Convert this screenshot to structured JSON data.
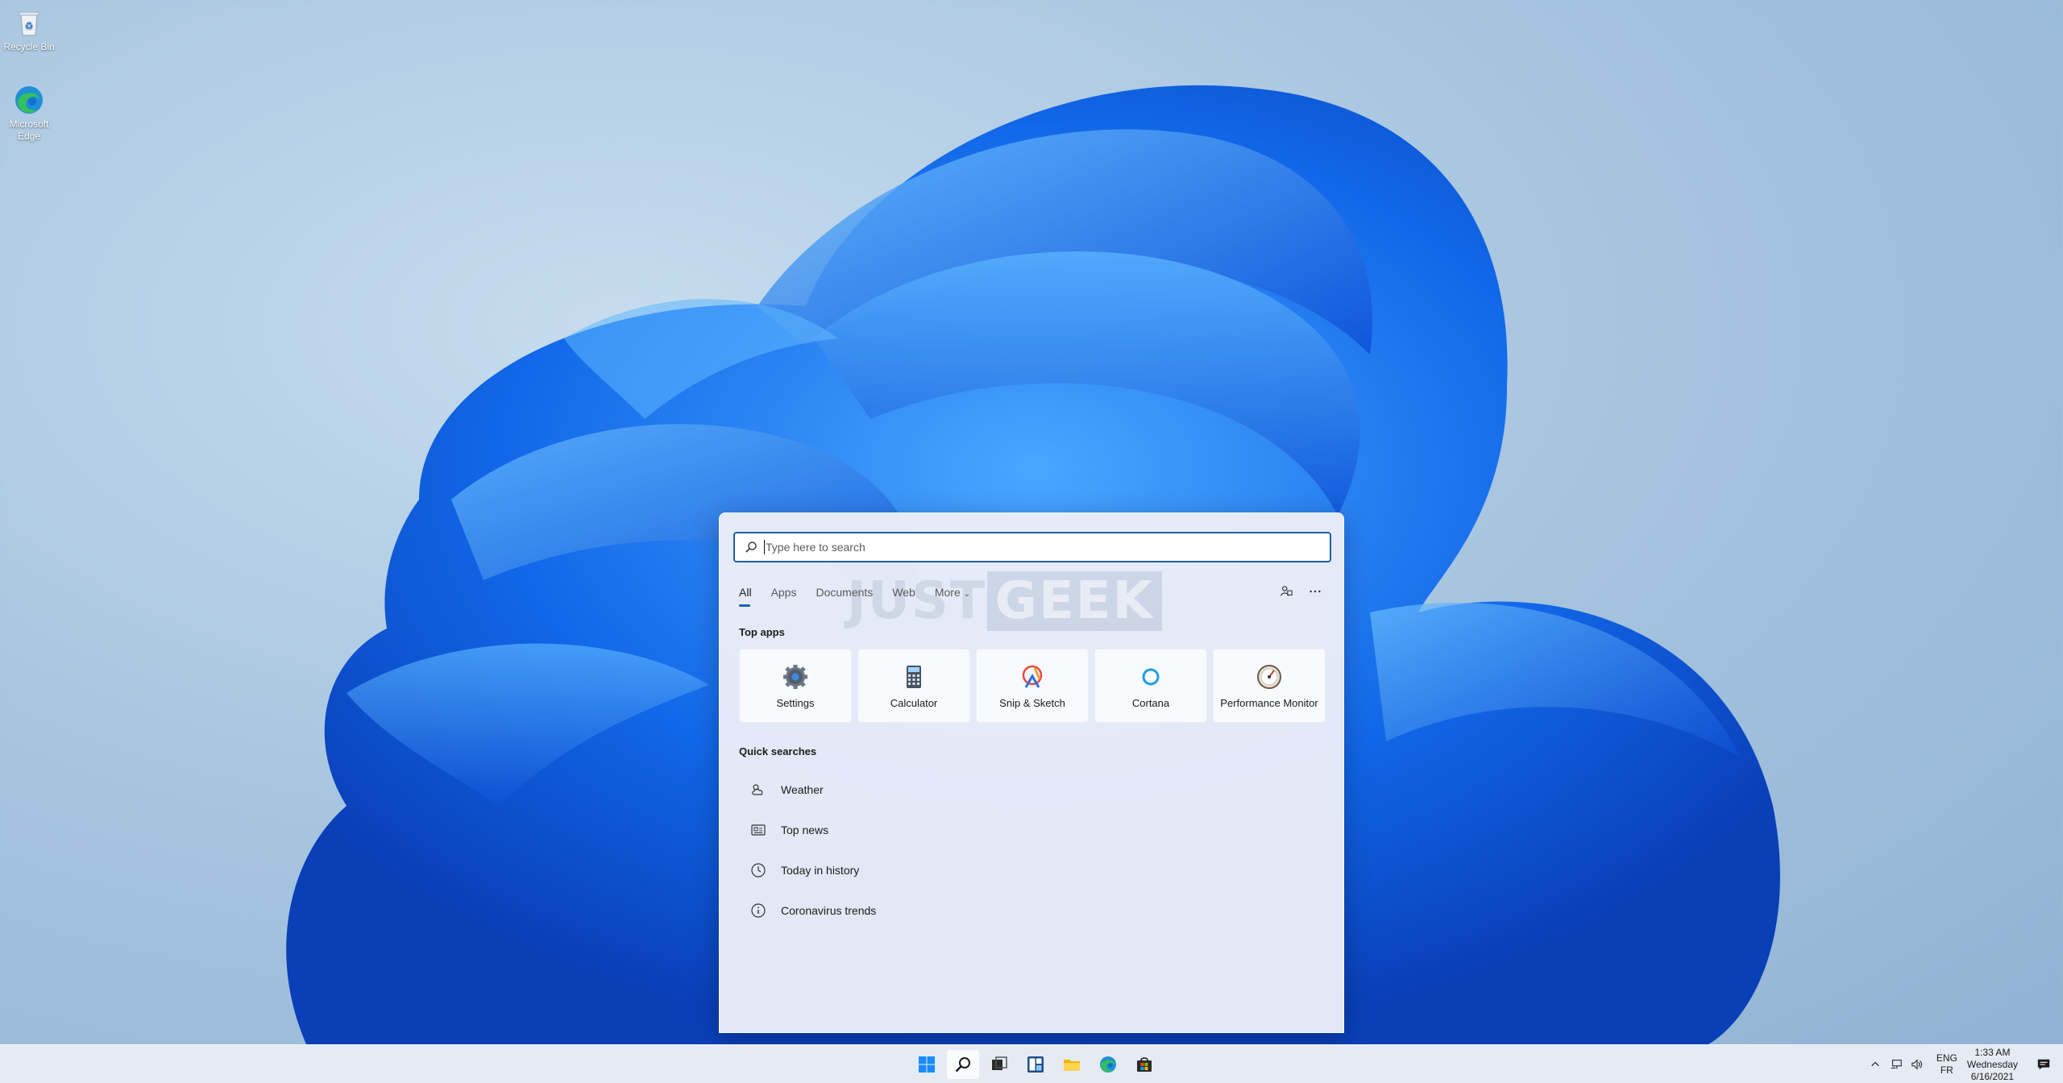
{
  "desktop": {
    "icons": [
      {
        "label": "Recycle Bin",
        "icon": "recycle-bin-icon"
      },
      {
        "label": "Microsoft Edge",
        "icon": "edge-icon"
      }
    ]
  },
  "search": {
    "placeholder": "Type here to search",
    "tabs": [
      "All",
      "Apps",
      "Documents",
      "Web",
      "More"
    ],
    "active_tab": "All",
    "watermark_left": "JUST",
    "watermark_right": "GEEK",
    "top_apps_title": "Top apps",
    "top_apps": [
      {
        "name": "Settings",
        "icon": "gear-icon"
      },
      {
        "name": "Calculator",
        "icon": "calculator-icon"
      },
      {
        "name": "Snip & Sketch",
        "icon": "snip-sketch-icon"
      },
      {
        "name": "Cortana",
        "icon": "cortana-icon"
      },
      {
        "name": "Performance Monitor",
        "icon": "performance-monitor-icon"
      }
    ],
    "quick_searches_title": "Quick searches",
    "quick_searches": [
      {
        "label": "Weather",
        "icon": "weather-icon"
      },
      {
        "label": "Top news",
        "icon": "news-icon"
      },
      {
        "label": "Today in history",
        "icon": "clock-icon"
      },
      {
        "label": "Coronavirus trends",
        "icon": "info-icon"
      }
    ]
  },
  "taskbar": {
    "apps": [
      "start-icon",
      "search-icon",
      "task-view-icon",
      "widgets-icon",
      "file-explorer-icon",
      "edge-icon",
      "store-icon"
    ],
    "language": {
      "line1": "ENG",
      "line2": "FR"
    },
    "clock": {
      "time": "1:33 AM",
      "day": "Wednesday",
      "date": "6/16/2021"
    }
  },
  "colors": {
    "accent": "#1f5fa9",
    "taskbar": "#e8ecf4",
    "panel": "#eceef8"
  }
}
